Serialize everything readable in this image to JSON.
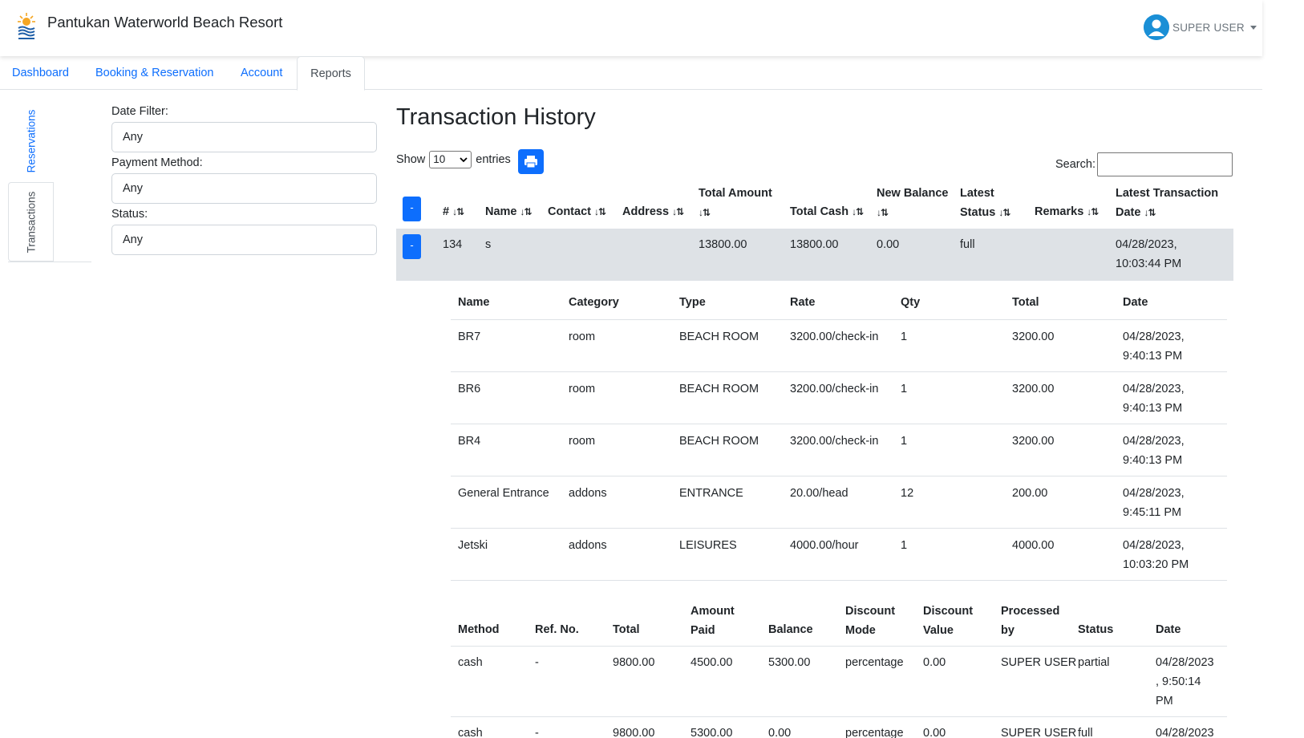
{
  "app": {
    "title": "Pantukan Waterworld Beach Resort",
    "user": "SUPER USER",
    "accent": "#0d6efd"
  },
  "nav": {
    "tabs": [
      {
        "label": "Dashboard"
      },
      {
        "label": "Booking & Reservation"
      },
      {
        "label": "Account"
      },
      {
        "label": "Reports",
        "active": true
      }
    ]
  },
  "side_tabs": [
    {
      "label": "Reservations"
    },
    {
      "label": "Transactions",
      "active": true
    }
  ],
  "filters": {
    "date_label": "Date Filter:",
    "date_value": "Any",
    "payment_label": "Payment Method:",
    "payment_value": "Any",
    "status_label": "Status:",
    "status_value": "Any"
  },
  "page": {
    "title": "Transaction History",
    "show_label": "Show",
    "entries_value": "10",
    "entries_label": "entries",
    "search_label": "Search:",
    "print_icon": "print-icon"
  },
  "main_table": {
    "headers": {
      "num": "#",
      "name": "Name",
      "contact": "Contact",
      "address": "Address",
      "total_amount_1": "Total Amount",
      "total_cash": "Total Cash",
      "new_balance_1": "New Balance",
      "latest_status_1": "Latest",
      "latest_status_2": "Status",
      "remarks": "Remarks",
      "latest_tx_1": "Latest Transaction",
      "latest_tx_2": "Date",
      "sort_icon": "↓⇅"
    },
    "row": {
      "toggle": "-",
      "num": "134",
      "name": "s",
      "contact": "",
      "address": "",
      "total_amount": "13800.00",
      "total_cash": "13800.00",
      "new_balance": "0.00",
      "latest_status": "full",
      "remarks": "",
      "date_1": "04/28/2023,",
      "date_2": "10:03:44 PM"
    },
    "header_toggle": "-"
  },
  "items_table": {
    "headers": [
      "Name",
      "Category",
      "Type",
      "Rate",
      "Qty",
      "Total",
      "Date"
    ],
    "rows": [
      {
        "name": "BR7",
        "category": "room",
        "type": "BEACH ROOM",
        "rate": "3200.00/check-in",
        "qty": "1",
        "total": "3200.00",
        "date_1": "04/28/2023,",
        "date_2": "9:40:13 PM"
      },
      {
        "name": "BR6",
        "category": "room",
        "type": "BEACH ROOM",
        "rate": "3200.00/check-in",
        "qty": "1",
        "total": "3200.00",
        "date_1": "04/28/2023,",
        "date_2": "9:40:13 PM"
      },
      {
        "name": "BR4",
        "category": "room",
        "type": "BEACH ROOM",
        "rate": "3200.00/check-in",
        "qty": "1",
        "total": "3200.00",
        "date_1": "04/28/2023,",
        "date_2": "9:40:13 PM"
      },
      {
        "name": "General Entrance",
        "category": "addons",
        "type": "ENTRANCE",
        "rate": "20.00/head",
        "qty": "12",
        "total": "200.00",
        "date_1": "04/28/2023,",
        "date_2": "9:45:11 PM"
      },
      {
        "name": "Jetski",
        "category": "addons",
        "type": "LEISURES",
        "rate": "4000.00/hour",
        "qty": "1",
        "total": "4000.00",
        "date_1": "04/28/2023,",
        "date_2": "10:03:20 PM"
      }
    ]
  },
  "payments_table": {
    "headers": {
      "method": "Method",
      "ref": "Ref. No.",
      "total": "Total",
      "paid_1": "Amount",
      "paid_2": "Paid",
      "balance": "Balance",
      "dmode_1": "Discount",
      "dmode_2": "Mode",
      "dvalue_1": "Discount",
      "dvalue_2": "Value",
      "processed_1": "Processed",
      "processed_2": "by",
      "status": "Status",
      "date": "Date"
    },
    "rows": [
      {
        "method": "cash",
        "ref": "-",
        "total": "9800.00",
        "paid": "4500.00",
        "balance": "5300.00",
        "dmode": "percentage",
        "dvalue": "0.00",
        "processed": "SUPER USER",
        "status": "partial",
        "date_1": "04/28/2023",
        "date_2": ", 9:50:14",
        "date_3": "PM"
      },
      {
        "method": "cash",
        "ref": "-",
        "total": "9800.00",
        "paid": "5300.00",
        "balance": "0.00",
        "dmode": "percentage",
        "dvalue": "0.00",
        "processed": "SUPER USER",
        "status": "full",
        "date_1": "04/28/2023",
        "date_2": "",
        "date_3": ""
      }
    ]
  }
}
